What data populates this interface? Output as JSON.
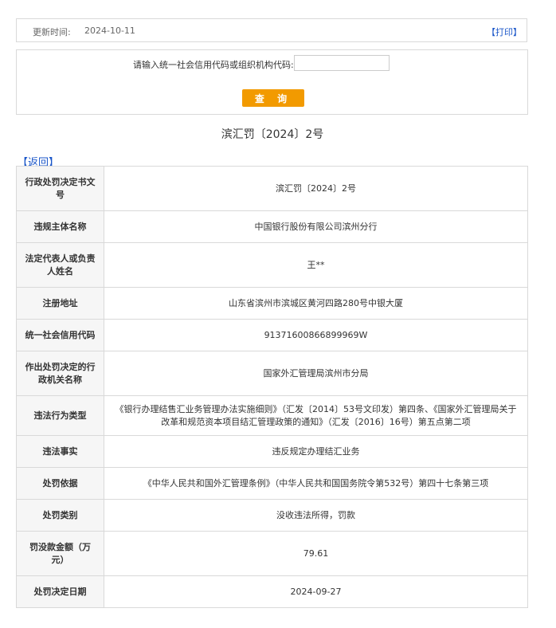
{
  "update": {
    "label": "更新时间:",
    "date": "2024-10-11",
    "print_label": "【打印】"
  },
  "query": {
    "prompt": "请输入统一社会信用代码或组织机构代码:",
    "input_value": "",
    "button_label": "查 询"
  },
  "doc_title": "滨汇罚〔2024〕2号",
  "back_label": "【返回】",
  "rows": [
    {
      "key": "行政处罚决定书文号",
      "value": "滨汇罚〔2024〕2号"
    },
    {
      "key": "违规主体名称",
      "value": "中国银行股份有限公司滨州分行"
    },
    {
      "key": "法定代表人或负责人姓名",
      "value": "王**"
    },
    {
      "key": "注册地址",
      "value": "山东省滨州市滨城区黄河四路280号中银大厦"
    },
    {
      "key": "统一社会信用代码",
      "value": "91371600866899969W"
    },
    {
      "key": "作出处罚决定的行政机关名称",
      "value": "国家外汇管理局滨州市分局"
    },
    {
      "key": "违法行为类型",
      "value": "《银行办理结售汇业务管理办法实施细则》（汇发〔2014〕53号文印发）第四条、《国家外汇管理局关于改革和规范资本项目结汇管理政策的通知》（汇发〔2016〕16号）第五点第二项"
    },
    {
      "key": "违法事实",
      "value": "违反规定办理结汇业务"
    },
    {
      "key": "处罚依据",
      "value": "《中华人民共和国外汇管理条例》（中华人民共和国国务院令第532号）第四十七条第三项"
    },
    {
      "key": "处罚类别",
      "value": "没收违法所得，罚款"
    },
    {
      "key": "罚没款金额（万元）",
      "value": "79.61"
    },
    {
      "key": "处罚决定日期",
      "value": "2024-09-27"
    }
  ]
}
